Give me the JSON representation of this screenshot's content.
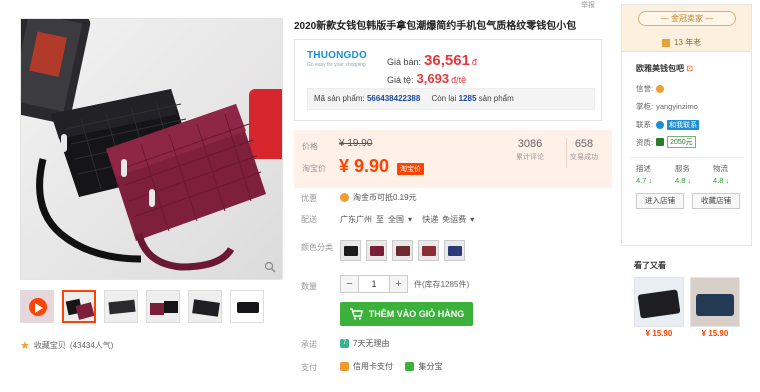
{
  "report_label": "举报",
  "gallery": {
    "favorite_label": "收藏宝贝",
    "favorite_count": "(43434人气)"
  },
  "product": {
    "title": "2020新款女钱包韩版手拿包潮爆简约手机包气质格纹零钱包小包"
  },
  "promo": {
    "logo_main": "THUONGDO",
    "logo_sub": "Go easy for your shopping",
    "gia_ban_label": "Giá bán:",
    "gia_ban_value": "36,561",
    "gia_ban_currency": "đ",
    "ti_gia_label": "Giá tệ:",
    "ti_gia_value": "3,693",
    "ti_gia_unit": "đ/tệ",
    "ma_sp_label": "Mã sản phẩm:",
    "ma_sp_value": "566438422388",
    "con_lai_label": "Còn lại",
    "con_lai_value": "1285",
    "con_lai_unit": "sản phẩm"
  },
  "price": {
    "price_label": "价格",
    "original": "¥ 19.90",
    "promo_label": "淘宝价",
    "promo_value": "¥ 9.90",
    "promo_badge": "淘宝价",
    "reviews_count": "3086",
    "reviews_label": "累计评论",
    "sales_count": "658",
    "sales_label": "交易成功"
  },
  "benefits": {
    "label": "优惠",
    "text": "淘金币可抵0.19元"
  },
  "shipping": {
    "label": "配送",
    "from": "广东广州",
    "to_label": "至",
    "to": "全国",
    "express": "快递",
    "fee": "免运费"
  },
  "colors": {
    "label": "颜色分类",
    "swatches": [
      "#1c1c1e",
      "#7a1f3b",
      "#6e2a2f",
      "#8b2c36",
      "#2b3a7a"
    ]
  },
  "quantity": {
    "label": "数量",
    "minus": "−",
    "value": "1",
    "plus": "+",
    "stock": "件(库存1285件)"
  },
  "cart": {
    "label": "THÊM VÀO GIỎ HÀNG"
  },
  "promise": {
    "label": "承诺",
    "text": "7天无理由"
  },
  "payment": {
    "label": "支付",
    "credit": "信用卡支付",
    "huabei": "集分宝"
  },
  "shop": {
    "badge": "金冠卖家",
    "years": "13 年老",
    "name": "欧雅美钱包吧",
    "credit_label": "信誉:",
    "seller_label": "掌柜:",
    "seller_name": "yangyinzimo",
    "contact_label": "联系:",
    "contact_btn": "和我联系",
    "qualify_label": "资质:",
    "deposit": "2050元",
    "dsr": [
      {
        "name": "描述",
        "score": "4.7 ↓"
      },
      {
        "name": "服务",
        "score": "4.8 ↓"
      },
      {
        "name": "物流",
        "score": "4.8 ↓"
      }
    ],
    "enter_shop": "进入店铺",
    "fav_shop": "收藏店铺"
  },
  "seen": {
    "title": "看了又看",
    "items": [
      {
        "price": "¥ 15.90"
      },
      {
        "price": "¥ 15.90"
      }
    ]
  }
}
